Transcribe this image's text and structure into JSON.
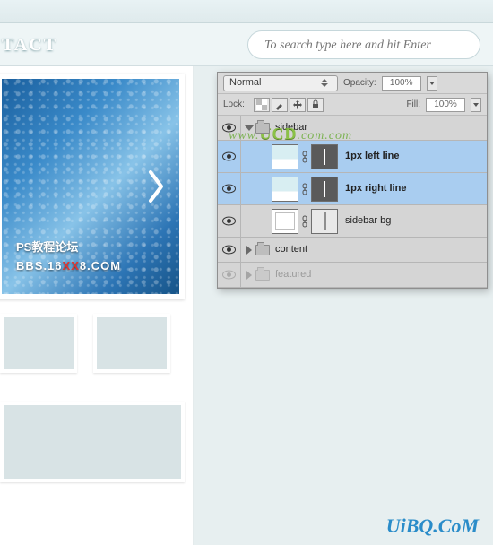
{
  "nav": {
    "item": "TACT"
  },
  "search": {
    "placeholder": "To search type here and hit Enter"
  },
  "slider": {
    "caption_line1": "PS教程论坛",
    "caption_line2_a": "BBS.16",
    "caption_line2_b": "XX",
    "caption_line2_c": "8.COM"
  },
  "panel": {
    "blend_mode": "Normal",
    "opacity_label": "Opacity:",
    "opacity_value": "100%",
    "lock_label": "Lock:",
    "fill_label": "Fill:",
    "fill_value": "100%",
    "layers": [
      {
        "type": "group",
        "name": "sidebar",
        "expanded": true,
        "visible": true
      },
      {
        "type": "layer",
        "name": "1px left line",
        "selected": true,
        "visible": true
      },
      {
        "type": "layer",
        "name": "1px right line",
        "selected": true,
        "visible": true
      },
      {
        "type": "layer",
        "name": "sidebar bg",
        "selected": false,
        "visible": true,
        "bg": true
      },
      {
        "type": "group",
        "name": "content",
        "expanded": false,
        "visible": true
      },
      {
        "type": "group",
        "name": "featured",
        "expanded": false,
        "visible": false,
        "dim": true
      }
    ]
  },
  "watermark": {
    "pre": "www.",
    "mid": "UCD",
    "post": ".com.com"
  },
  "brand": "UiBQ.CoM"
}
